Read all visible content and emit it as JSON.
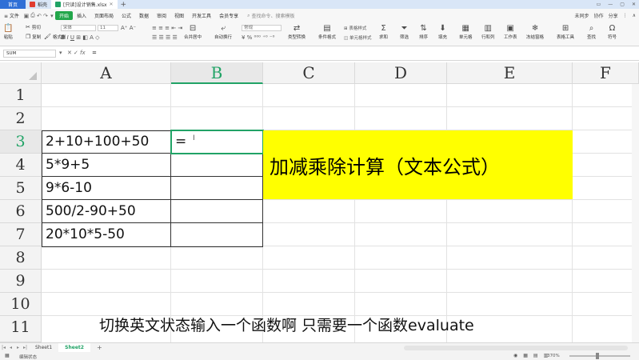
{
  "titlebar": {
    "home": "首页",
    "tabs": [
      {
        "label": "稻壳",
        "color": "#e03c31"
      },
      {
        "label": "[只读]设计销售.xlsx",
        "color": "#21a366"
      }
    ],
    "new_tab": "+",
    "window_controls": [
      "▭",
      "—",
      "▢",
      "✕"
    ]
  },
  "menubar": {
    "file": "≡ 文件",
    "items": [
      "开始",
      "插入",
      "页面布局",
      "公式",
      "数据",
      "审阅",
      "视图",
      "开发工具",
      "会员专享"
    ],
    "active_index": 0,
    "search": "查找命令、搜索模板",
    "right": {
      "sync": "未同步",
      "collab": "协作",
      "share": "分享"
    }
  },
  "ribbon": {
    "paste": "粘贴",
    "cut": "剪切",
    "copy": "复制",
    "format_painter": "格式刷",
    "font": "宋体",
    "font_size": "11",
    "merge": "合并居中",
    "wrap": "自动换行",
    "number_format": "常规",
    "type_convert": "类型转换",
    "conditional_format": "条件格式",
    "table_style": "表格样式",
    "cell_style": "单元格样式",
    "sum": "求和",
    "filter": "筛选",
    "sort": "排序",
    "fill": "填充",
    "cell": "单元格",
    "row_col": "行和列",
    "worksheet": "工作表",
    "freeze": "冻结窗格",
    "table_tools": "表格工具",
    "find": "查找",
    "symbol": "符号"
  },
  "formulabar": {
    "cell_ref": "SUM",
    "fx": "fx",
    "content": "="
  },
  "grid": {
    "columns": [
      "A",
      "B",
      "C",
      "D",
      "E",
      "F"
    ],
    "rows": [
      "1",
      "2",
      "3",
      "4",
      "5",
      "6",
      "7",
      "8",
      "9",
      "10",
      "11"
    ],
    "selected_column": "B",
    "selected_row": "3",
    "cells": {
      "A3": "2+10+100+50",
      "A4": "5*9+5",
      "A5": "9*6-10",
      "A6": "500/2-90+50",
      "A7": "20*10*5-50",
      "B3": "="
    },
    "banner": "加减乘除计算（文本公式）",
    "banner_color": "#ffff00"
  },
  "subtitle": "切换英文状态输入一个函数啊 只需要一个函数evaluate",
  "sheets": {
    "tabs": [
      "Sheet1",
      "Sheet2"
    ],
    "active": "Sheet2",
    "add": "+"
  },
  "statusbar": {
    "mode": "编辑状态",
    "zoom": "370%"
  }
}
